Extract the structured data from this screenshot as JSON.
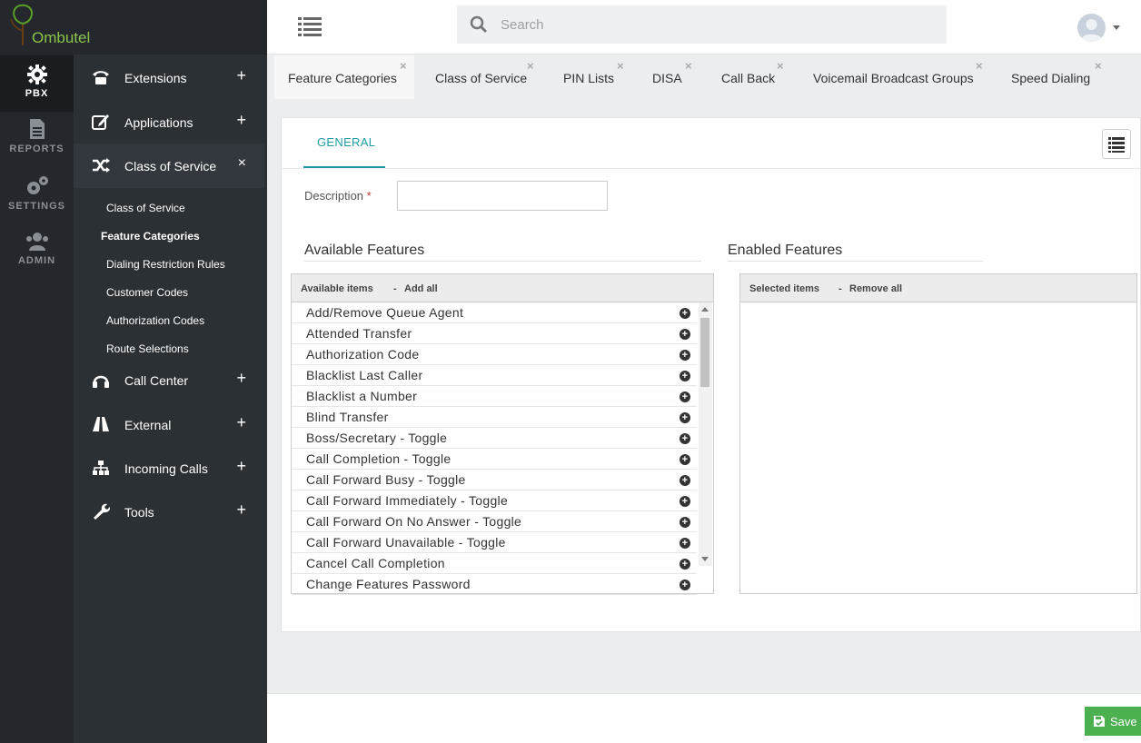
{
  "app": {
    "name": "Ombutel"
  },
  "rail": [
    {
      "label": "PBX",
      "icon": "gear-icon",
      "active": true
    },
    {
      "label": "REPORTS",
      "icon": "document-icon",
      "active": false
    },
    {
      "label": "SETTINGS",
      "icon": "gears-icon",
      "active": false
    },
    {
      "label": "ADMIN",
      "icon": "users-icon",
      "active": false
    }
  ],
  "menu": {
    "items": [
      {
        "label": "Extensions",
        "icon": "phone-icon",
        "toggle": "+"
      },
      {
        "label": "Applications",
        "icon": "edit-icon",
        "toggle": "+"
      },
      {
        "label": "Class of Service",
        "icon": "shuffle-icon",
        "toggle": "×"
      },
      {
        "label": "Call Center",
        "icon": "headset-icon",
        "toggle": "+"
      },
      {
        "label": "External",
        "icon": "road-icon",
        "toggle": "+"
      },
      {
        "label": "Incoming Calls",
        "icon": "sitemap-icon",
        "toggle": "+"
      },
      {
        "label": "Tools",
        "icon": "wrench-icon",
        "toggle": "+"
      }
    ],
    "sub_items": [
      "Class of Service",
      "Feature Categories",
      "Dialing Restriction Rules",
      "Customer Codes",
      "Authorization Codes",
      "Route Selections"
    ],
    "selected_sub": "Feature Categories"
  },
  "search": {
    "placeholder": "Search",
    "value": ""
  },
  "tabs": [
    {
      "label": "Feature Categories",
      "close": "×",
      "active": true
    },
    {
      "label": "Class of Service",
      "close": "×"
    },
    {
      "label": "PIN Lists",
      "close": "×"
    },
    {
      "label": "DISA",
      "close": "×"
    },
    {
      "label": "Call Back",
      "close": "×"
    },
    {
      "label": "Voicemail Broadcast Groups",
      "close": "×"
    },
    {
      "label": "Speed Dialing",
      "close": "×"
    }
  ],
  "form": {
    "tab_label": "GENERAL",
    "description_label": "Description",
    "required_mark": "*",
    "description_value": ""
  },
  "available": {
    "title": "Available Features",
    "header_label": "Available items",
    "separator": "-",
    "add_all": "Add all",
    "items": [
      "Add/Remove Queue Agent",
      "Attended Transfer",
      "Authorization Code",
      "Blacklist Last Caller",
      "Blacklist a Number",
      "Blind Transfer",
      "Boss/Secretary - Toggle",
      "Call Completion - Toggle",
      "Call Forward Busy - Toggle",
      "Call Forward Immediately - Toggle",
      "Call Forward On No Answer - Toggle",
      "Call Forward Unavailable - Toggle",
      "Cancel Call Completion",
      "Change Features Password"
    ]
  },
  "enabled": {
    "title": "Enabled Features",
    "header_label": "Selected items",
    "separator": "-",
    "remove_all": "Remove all"
  },
  "footer": {
    "save_label": "Save"
  },
  "colors": {
    "accent": "#1f9ba3",
    "save": "#4caf50",
    "sidebar": "#24282c"
  }
}
